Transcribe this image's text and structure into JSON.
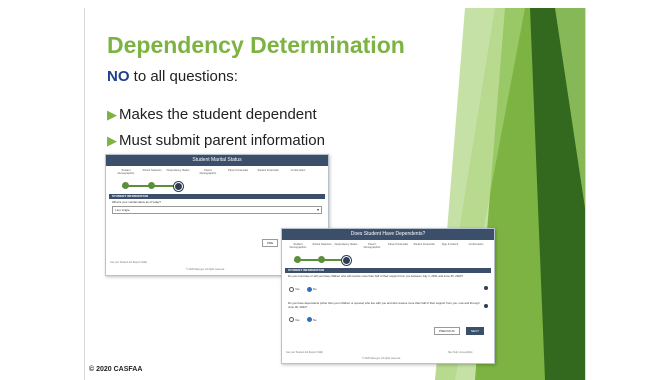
{
  "slide": {
    "title": "Dependency Determination",
    "subtitle_no": "NO",
    "subtitle_rest": " to all questions:",
    "bullets": [
      "Makes the student dependent",
      "Must submit parent information"
    ],
    "footer": "© 2020 CASFAA",
    "colors": {
      "accent": "#7cb342",
      "navy": "#1e3f8a",
      "header": "#3b4f6b"
    }
  },
  "shot1": {
    "header": "Student Marital Status",
    "steps": [
      "Student Demographics",
      "School Selection",
      "Dependency Status",
      "Parent Demographics",
      "Parent Financials",
      "Student Financials",
      "Confirmation"
    ],
    "section": "STUDENT INFORMATION",
    "question": "What is your marital status as of today?",
    "select_value": "I am single",
    "prev_label": "PRE",
    "footer_left": "Get your Student Aid Report (SAR)",
    "footer_center": "© 2020 fafsa.gov. All rights reserved."
  },
  "shot2": {
    "header": "Does Student Have Dependents?",
    "steps": [
      "Student Demographics",
      "School Selection",
      "Dependency Status",
      "Parent Demographics",
      "Parent Financials",
      "Student Financials",
      "Sign & Submit",
      "Confirmation"
    ],
    "section": "STUDENT INFORMATION",
    "q1": "Do you now have or will you have children who will receive more than half of their support from you between July 1, 2021 and June 30, 2022?",
    "q2": "Do you have dependents (other than your children or spouse) who live with you and who receive more than half of their support from you, now and through June 30, 2022?",
    "yes": "Yes",
    "no": "No",
    "prev_label": "PREVIOUS",
    "next_label": "NEXT",
    "footer_left": "Get your Student Aid Report (SAR)",
    "footer_center": "© 2020 fafsa.gov. All rights reserved.",
    "footer_right": "Site Help / Accessibility"
  }
}
